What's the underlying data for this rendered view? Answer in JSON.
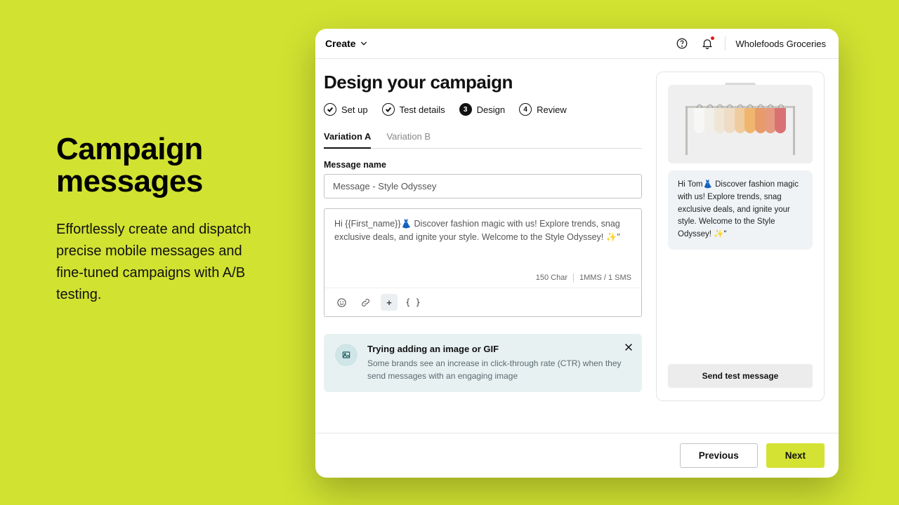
{
  "promo": {
    "heading": "Campaign messages",
    "body": "Effortlessly create and dispatch precise mobile messages and fine-tuned campaigns with A/B testing."
  },
  "topbar": {
    "create_label": "Create",
    "workspace": "Wholefoods Groceries"
  },
  "page": {
    "title": "Design your campaign"
  },
  "steps": {
    "s1": "Set up",
    "s2": "Test details",
    "s3": "Design",
    "s4": "Review",
    "s4_num": "4"
  },
  "tabs": {
    "a": "Variation A",
    "b": "Variation  B"
  },
  "message": {
    "name_label": "Message name",
    "name_value": "Message - Style Odyssey",
    "body": "Hi {{First_name}}👗 Discover fashion magic with us! Explore trends, snag exclusive deals, and ignite your style. Welcome to the Style Odyssey! ✨\"",
    "char_count": "150 Char",
    "sms_count": "1MMS / 1 SMS"
  },
  "tip": {
    "title": "Trying adding an image or GIF",
    "body": "Some brands see an increase in click-through rate (CTR) when they send messages with an engaging image"
  },
  "preview": {
    "bubble": "Hi Tom👗 Discover fashion magic with us! Explore trends, snag exclusive deals, and ignite your style. Welcome to the Style Odyssey! ✨\"",
    "send_test": "Send test message"
  },
  "footer": {
    "prev": "Previous",
    "next": "Next"
  }
}
